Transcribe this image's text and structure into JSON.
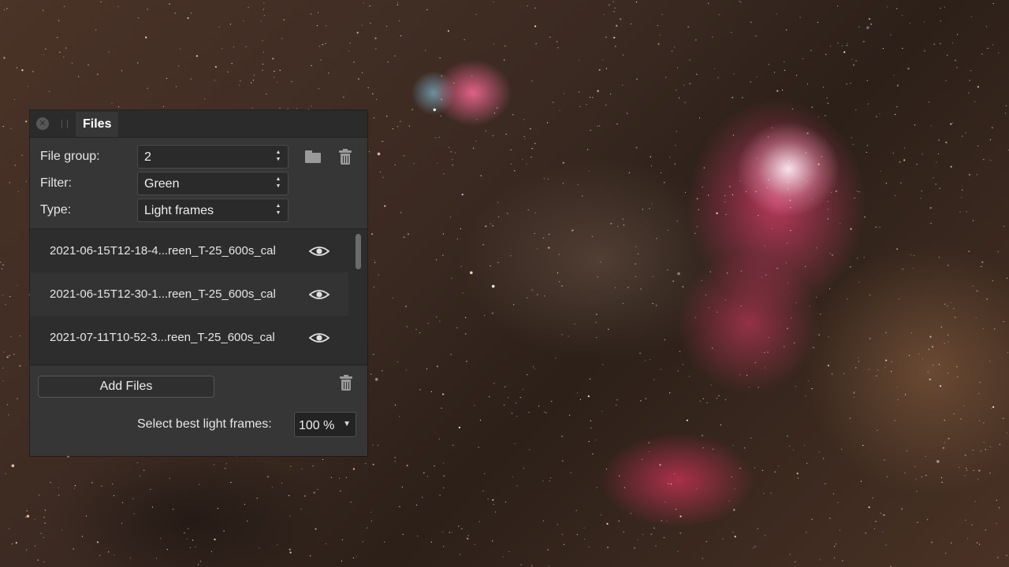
{
  "panel": {
    "tab_label": "Files",
    "close_glyph": "✕",
    "file_group": {
      "label": "File group:",
      "value": "2"
    },
    "filter": {
      "label": "Filter:",
      "value": "Green"
    },
    "type": {
      "label": "Type:",
      "value": "Light frames"
    },
    "files": [
      {
        "name": "2021-06-15T12-18-4...reen_T-25_600s_cal",
        "icon": "eye-icon"
      },
      {
        "name": "2021-06-15T12-30-1...reen_T-25_600s_cal",
        "icon": "eye-icon"
      },
      {
        "name": "2021-07-11T10-52-3...reen_T-25_600s_cal",
        "icon": "eye-icon"
      }
    ],
    "add_files_label": "Add Files",
    "best_frames": {
      "label": "Select best light frames:",
      "value": "100 %"
    }
  },
  "icons": {
    "group_folder": "folder-icon",
    "group_delete": "trash-icon",
    "list_delete": "trash-icon"
  },
  "colors": {
    "panel_bg": "#363636",
    "header_bg": "#2b2b2b",
    "list_bg": "#2d2d2d",
    "text": "#e6e6e6"
  }
}
